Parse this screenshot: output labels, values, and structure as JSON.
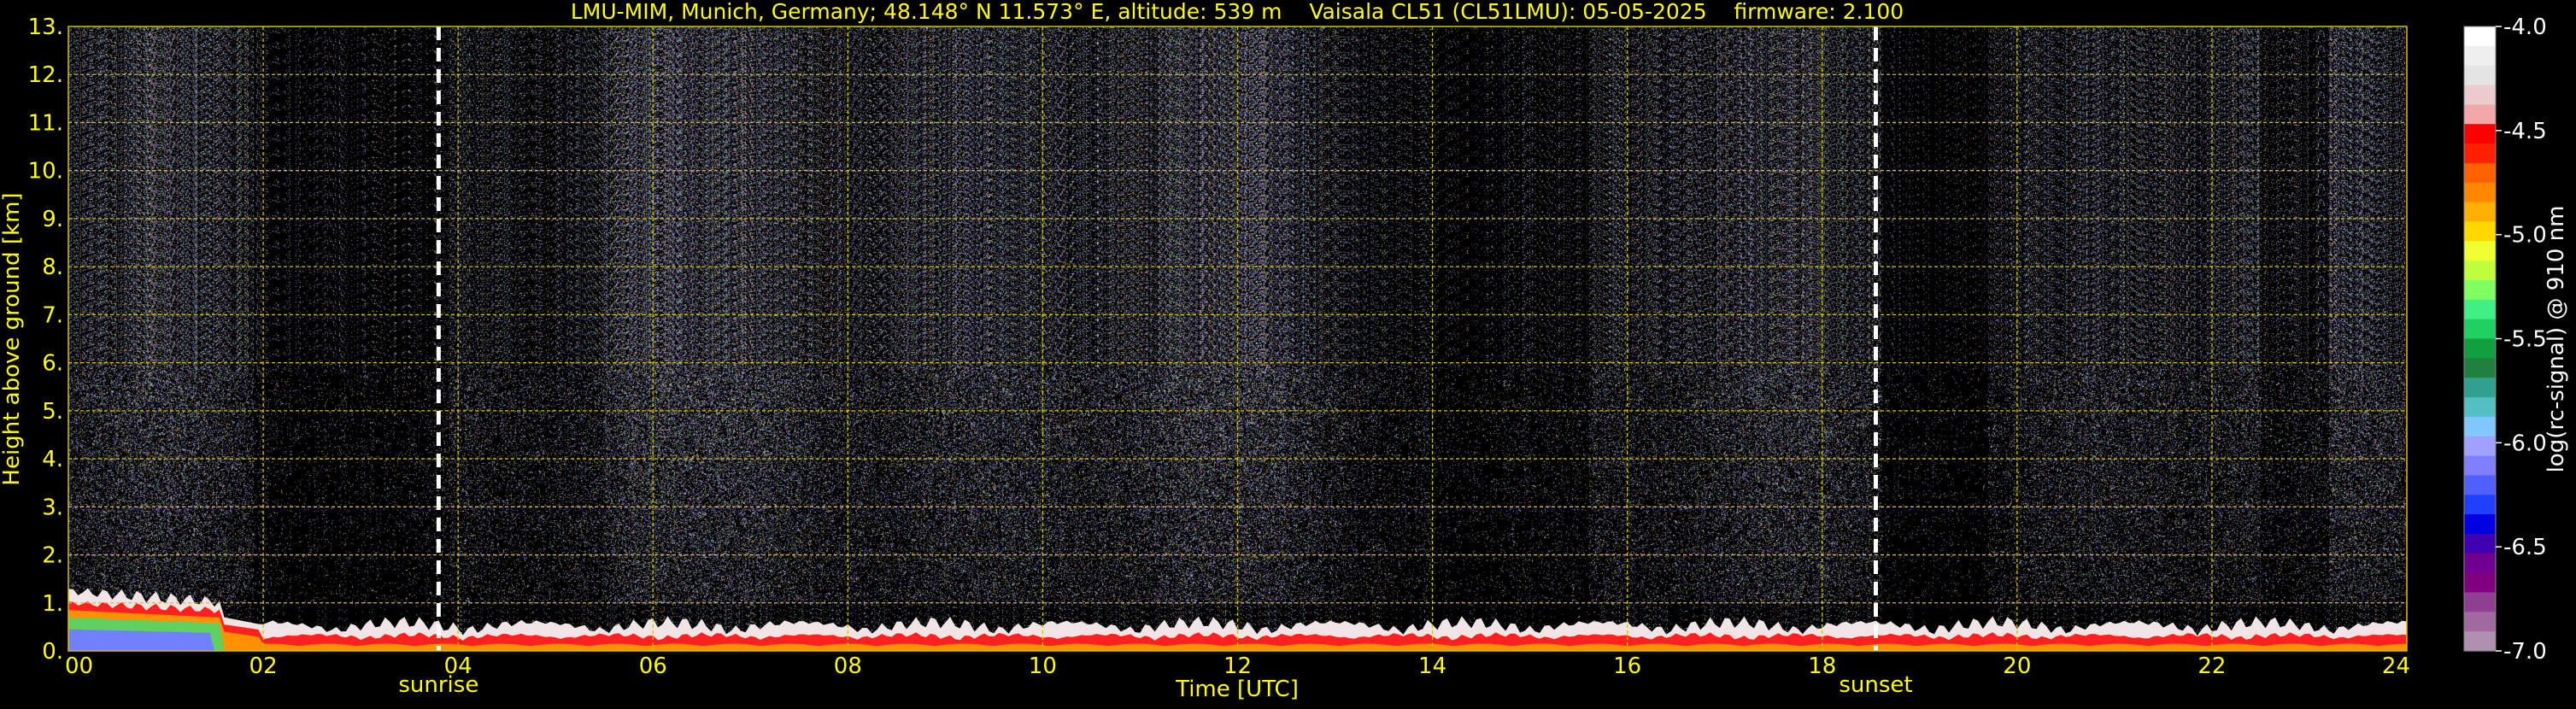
{
  "chart_data": {
    "type": "heatmap",
    "title": "LMU-MIM, Munich, Germany; 48.148° N 11.573° E, altitude: 539 m    Vaisala CL51 (CL51LMU): 05-05-2025    firmware: 2.100",
    "xlabel": "Time [UTC]",
    "ylabel": "Height above ground [km]",
    "xlim": [
      0,
      24
    ],
    "ylim": [
      0,
      13
    ],
    "x_ticks": [
      "00",
      "02",
      "04",
      "06",
      "08",
      "10",
      "12",
      "14",
      "16",
      "18",
      "20",
      "22",
      "24"
    ],
    "y_ticks": [
      "0.",
      "1.",
      "2.",
      "3.",
      "4.",
      "5.",
      "6.",
      "7.",
      "8.",
      "9.",
      "10.",
      "11.",
      "12.",
      "13."
    ],
    "grid": true,
    "markers": [
      {
        "label": "sunrise",
        "time": 3.8
      },
      {
        "label": "sunset",
        "time": 18.55
      }
    ],
    "colorbar": {
      "label": "log(rc-signal) @ 910 nm",
      "range": [
        -7.0,
        -4.0
      ],
      "ticks": [
        "-4.0",
        "-4.5",
        "-5.0",
        "-5.5",
        "-6.0",
        "-6.5",
        "-7.0"
      ],
      "colors_top_to_bottom": [
        "#ffffff",
        "#f0f0f0",
        "#e4e4e4",
        "#eccccc",
        "#f2a8a8",
        "#ff0000",
        "#ff2000",
        "#ff6000",
        "#ff8800",
        "#ffb000",
        "#ffd800",
        "#f0ff30",
        "#c0ff40",
        "#80ff60",
        "#40f080",
        "#20d060",
        "#10a040",
        "#208040",
        "#30a090",
        "#50c0c0",
        "#80c8ff",
        "#a0a0ff",
        "#8080ff",
        "#5060ff",
        "#2040ff",
        "#0000e0",
        "#4000b0",
        "#700090",
        "#800080",
        "#904090",
        "#a06aa0",
        "#b090b0"
      ]
    },
    "style": {
      "text_color": "#ffff00",
      "grid_color": "#d4c000",
      "background": "#000000",
      "marker_color": "#ffffff"
    }
  }
}
